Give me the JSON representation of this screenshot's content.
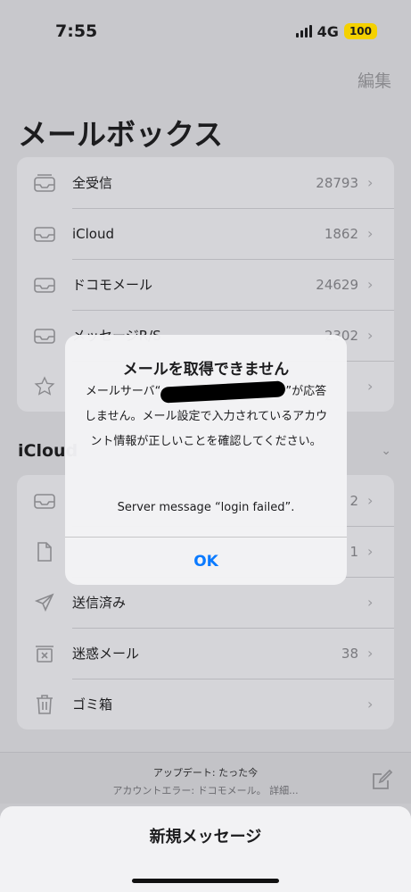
{
  "status": {
    "time": "7:55",
    "network": "4G",
    "battery": "100"
  },
  "nav": {
    "edit_label": "編集",
    "title": "メールボックス"
  },
  "mailboxes": [
    {
      "label": "全受信",
      "count": "28793",
      "icon": "tray-stack-icon"
    },
    {
      "label": "iCloud",
      "count": "1862",
      "icon": "tray-icon"
    },
    {
      "label": "ドコモメール",
      "count": "24629",
      "icon": "tray-icon"
    },
    {
      "label": "メッセージR/S",
      "count": "2302",
      "icon": "tray-icon"
    },
    {
      "label": "",
      "count": "",
      "icon": "star-icon"
    }
  ],
  "icloud_section": {
    "title": "iCloud"
  },
  "icloud_folders": [
    {
      "label": "",
      "count": "2",
      "icon": "tray-icon"
    },
    {
      "label": "",
      "count": "1",
      "icon": "document-icon"
    },
    {
      "label": "送信済み",
      "count": "",
      "icon": "paper-plane-icon"
    },
    {
      "label": "迷惑メール",
      "count": "38",
      "icon": "junk-box-icon"
    },
    {
      "label": "ゴミ箱",
      "count": "",
      "icon": "trash-icon"
    }
  ],
  "toolbar": {
    "update_text": "アップデート: たった今",
    "error_text": "アカウントエラー: ドコモメール。 詳細..."
  },
  "sheet": {
    "title": "新規メッセージ"
  },
  "alert": {
    "title": "メールを取得できません",
    "body_prefix": "メールサーバ“",
    "body_suffix": "”が応答しません。メール設定で入力されているアカウント情報が正しいことを確認してください。",
    "server_message": "Server message “login failed”.",
    "ok_label": "OK"
  },
  "colors": {
    "accent": "#0a7aff",
    "battery": "#f4d100"
  }
}
